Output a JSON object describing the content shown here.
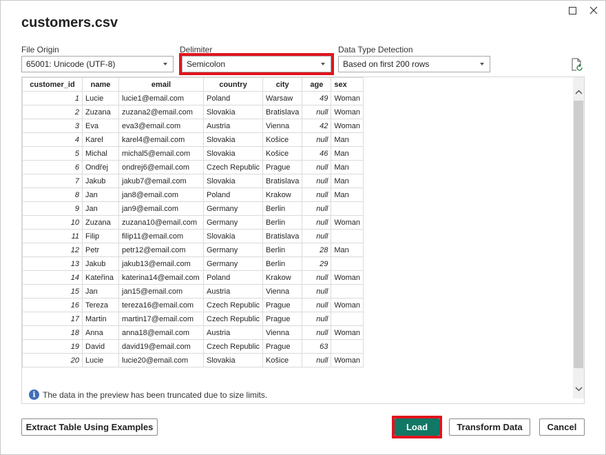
{
  "dialog": {
    "title": "customers.csv",
    "controls": {
      "maximize_icon": "maximize-icon",
      "close_icon": "close-icon"
    }
  },
  "options": {
    "file_origin": {
      "label": "File Origin",
      "value": "65001: Unicode (UTF-8)"
    },
    "delimiter": {
      "label": "Delimiter",
      "value": "Semicolon"
    },
    "data_type_detection": {
      "label": "Data Type Detection",
      "value": "Based on first 200 rows"
    },
    "refresh_icon": "refresh-file-icon"
  },
  "table": {
    "columns": [
      "customer_id",
      "name",
      "email",
      "country",
      "city",
      "age",
      "sex"
    ],
    "rows": [
      [
        "1",
        "Lucie",
        "lucie1@email.com",
        "Poland",
        "Warsaw",
        "49",
        "Woman"
      ],
      [
        "2",
        "Zuzana",
        "zuzana2@email.com",
        "Slovakia",
        "Bratislava",
        "null",
        "Woman"
      ],
      [
        "3",
        "Eva",
        "eva3@email.com",
        "Austria",
        "Vienna",
        "42",
        "Woman"
      ],
      [
        "4",
        "Karel",
        "karel4@email.com",
        "Slovakia",
        "Košice",
        "null",
        "Man"
      ],
      [
        "5",
        "Michal",
        "michal5@email.com",
        "Slovakia",
        "Košice",
        "46",
        "Man"
      ],
      [
        "6",
        "Ondřej",
        "ondrej6@email.com",
        "Czech Republic",
        "Prague",
        "null",
        "Man"
      ],
      [
        "7",
        "Jakub",
        "jakub7@email.com",
        "Slovakia",
        "Bratislava",
        "null",
        "Man"
      ],
      [
        "8",
        "Jan",
        "jan8@email.com",
        "Poland",
        "Krakow",
        "null",
        "Man"
      ],
      [
        "9",
        "Jan",
        "jan9@email.com",
        "Germany",
        "Berlin",
        "null",
        ""
      ],
      [
        "10",
        "Zuzana",
        "zuzana10@email.com",
        "Germany",
        "Berlin",
        "null",
        "Woman"
      ],
      [
        "11",
        "Filip",
        "filip11@email.com",
        "Slovakia",
        "Bratislava",
        "null",
        ""
      ],
      [
        "12",
        "Petr",
        "petr12@email.com",
        "Germany",
        "Berlin",
        "28",
        "Man"
      ],
      [
        "13",
        "Jakub",
        "jakub13@email.com",
        "Germany",
        "Berlin",
        "29",
        ""
      ],
      [
        "14",
        "Kateřina",
        "katerina14@email.com",
        "Poland",
        "Krakow",
        "null",
        "Woman"
      ],
      [
        "15",
        "Jan",
        "jan15@email.com",
        "Austria",
        "Vienna",
        "null",
        ""
      ],
      [
        "16",
        "Tereza",
        "tereza16@email.com",
        "Czech Republic",
        "Prague",
        "null",
        "Woman"
      ],
      [
        "17",
        "Martin",
        "martin17@email.com",
        "Czech Republic",
        "Prague",
        "null",
        ""
      ],
      [
        "18",
        "Anna",
        "anna18@email.com",
        "Austria",
        "Vienna",
        "null",
        "Woman"
      ],
      [
        "19",
        "David",
        "david19@email.com",
        "Czech Republic",
        "Prague",
        "63",
        ""
      ],
      [
        "20",
        "Lucie",
        "lucie20@email.com",
        "Slovakia",
        "Košice",
        "null",
        "Woman"
      ]
    ]
  },
  "info": {
    "text": "The data in the preview has been truncated due to size limits.",
    "icon": "info-icon"
  },
  "buttons": {
    "extract": "Extract Table Using Examples",
    "load": "Load",
    "transform": "Transform Data",
    "cancel": "Cancel"
  },
  "colors": {
    "primary": "#117865",
    "highlight": "#e2141e",
    "info": "#3f6fb6"
  }
}
